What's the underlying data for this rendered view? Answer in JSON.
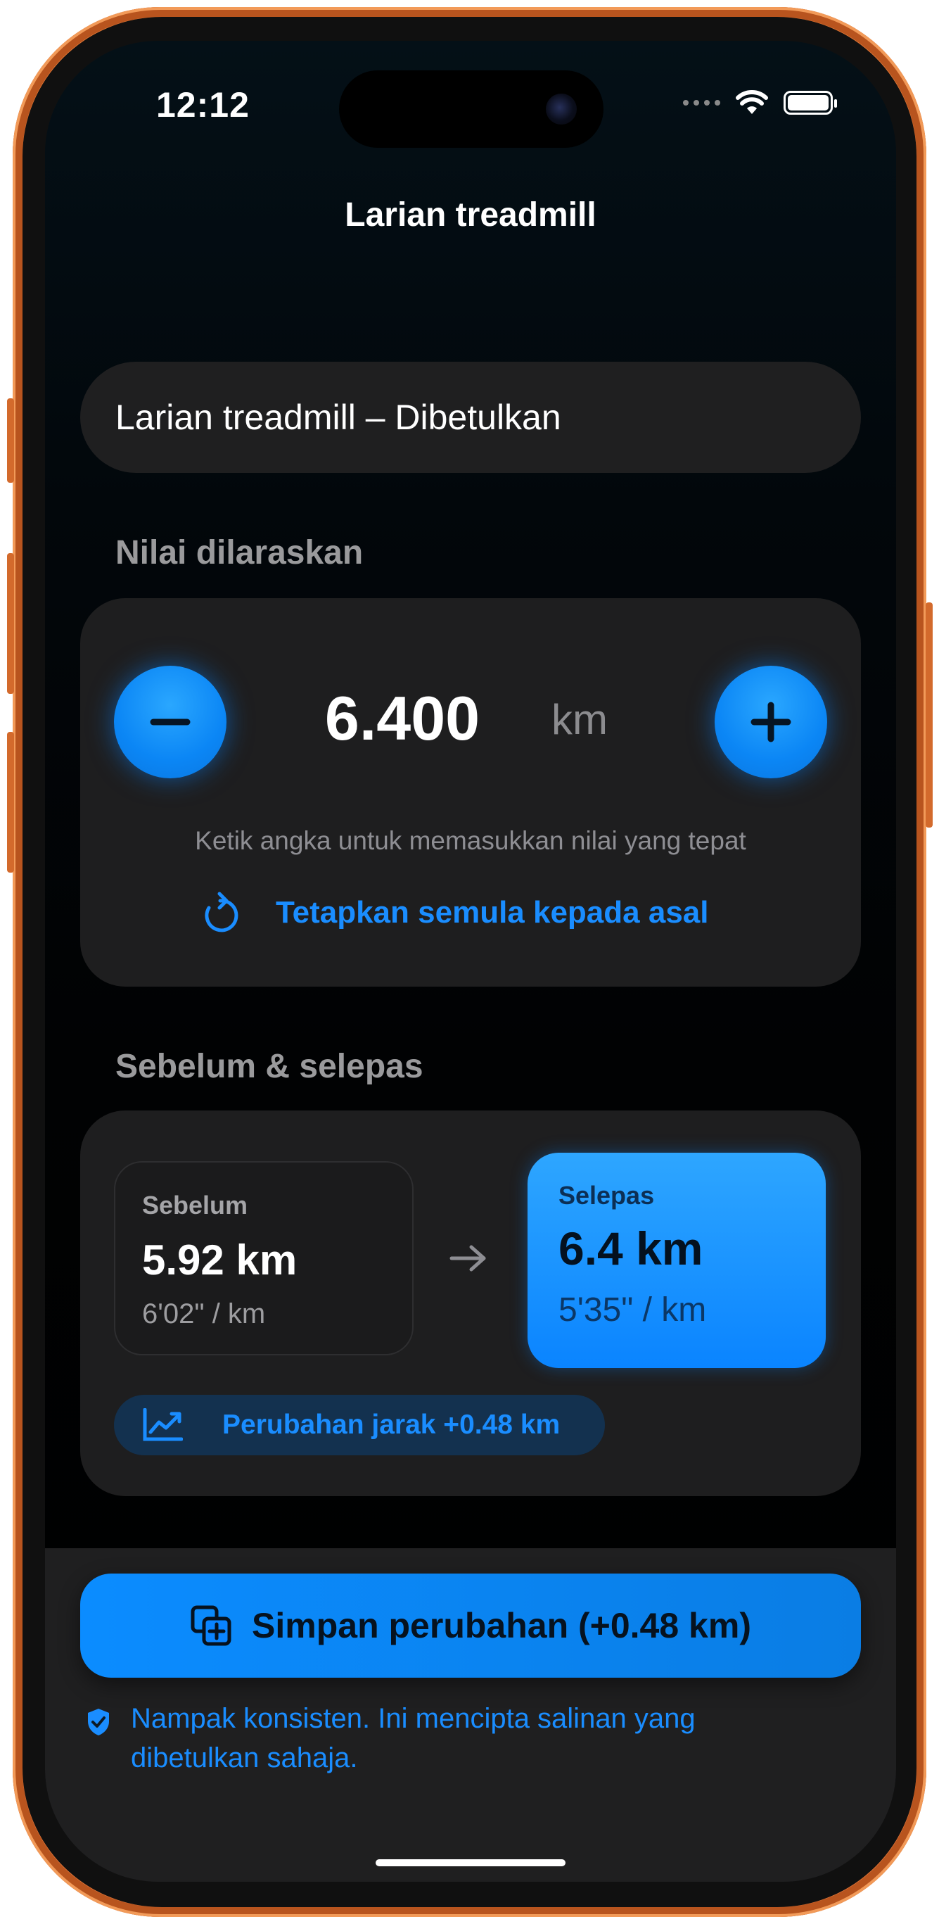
{
  "status": {
    "time": "12:12"
  },
  "nav": {
    "title": "Larian treadmill"
  },
  "name_field": {
    "value": "Larian treadmill – Dibetulkan"
  },
  "adjust": {
    "section_label": "Nilai dilaraskan",
    "value": "6.400",
    "unit": "km",
    "hint": "Ketik angka untuk memasukkan nilai yang tepat",
    "reset_label": "Tetapkan semula kepada asal",
    "decrement_icon": "minus-icon",
    "increment_icon": "plus-icon"
  },
  "compare": {
    "section_label": "Sebelum & selepas",
    "before": {
      "label": "Sebelum",
      "value": "5.92 km",
      "pace": "6'02\" / km"
    },
    "after": {
      "label": "Selepas",
      "value": "6.4 km",
      "pace": "5'35\" / km"
    },
    "change_label": "Perubahan jarak +0.48 km"
  },
  "footer": {
    "save_label": "Simpan perubahan (+0.48 km)",
    "notice": "Nampak konsisten. Ini mencipta salinan yang dibetulkan sahaja."
  },
  "colors": {
    "accent": "#0a84ff",
    "frame": "#e67d3a",
    "card": "#1e1e1f"
  }
}
